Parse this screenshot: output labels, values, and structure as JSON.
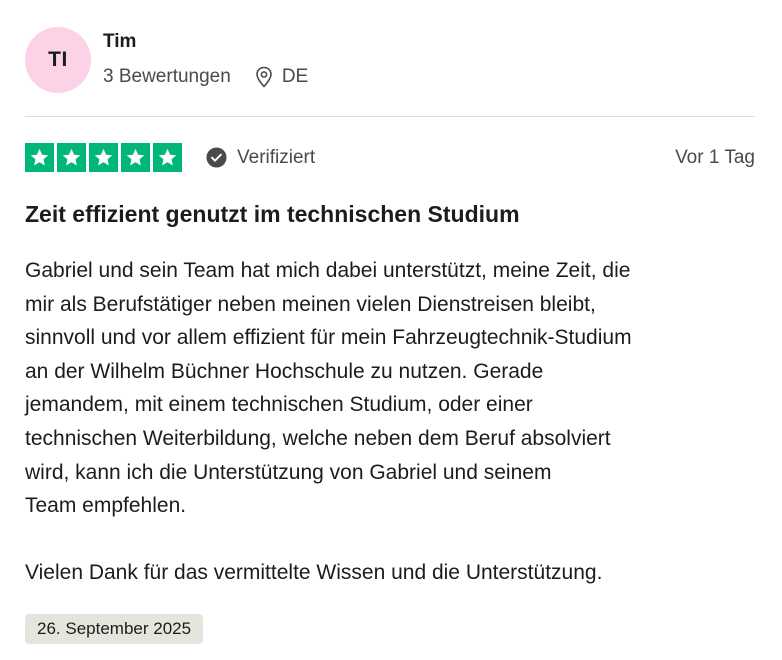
{
  "reviewer": {
    "initials": "TI",
    "name": "Tim",
    "review_count": "3 Bewertungen",
    "country": "DE",
    "avatar_color": "#fcd3e6"
  },
  "rating": {
    "stars": 5,
    "max_stars": 5,
    "star_color": "#00b67a",
    "verified_label": "Verifiziert",
    "relative_date": "Vor 1 Tag"
  },
  "review": {
    "title": "Zeit effizient genutzt im technischen Studium",
    "paragraphs": [
      "Gabriel und sein Team hat mich dabei unterstützt, meine Zeit, die\nmir als Berufstätiger neben meinen vielen Dienstreisen bleibt,\nsinnvoll und vor allem effizient für mein Fahrzeugtechnik-Studium\nan der Wilhelm Büchner Hochschule zu nutzen. Gerade\njemandem, mit einem technischen Studium, oder einer\ntechnischen Weiterbildung, welche neben dem Beruf absolviert\nwird, kann ich die Unterstützung von Gabriel und seinem\nTeam empfehlen.",
      "Vielen Dank für das vermittelte Wissen und die Unterstützung."
    ],
    "experience_date": "26. September 2025"
  }
}
